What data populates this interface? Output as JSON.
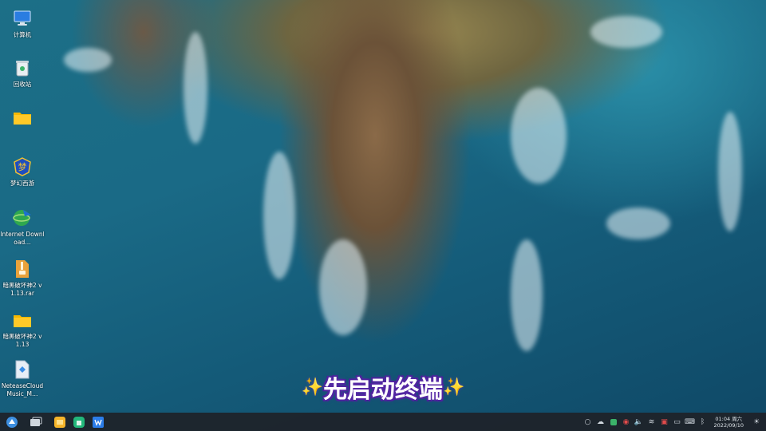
{
  "desktop": {
    "icons": [
      {
        "label": "计算机",
        "icon": "computer-icon"
      },
      {
        "label": "回收站",
        "icon": "trash-icon"
      },
      {
        "label": "",
        "icon": "folder-icon"
      },
      {
        "label": "梦幻西游",
        "icon": "game-icon"
      },
      {
        "label": "Internet Download…",
        "icon": "idm-icon"
      },
      {
        "label": "暗黑破坏神2 v1.13.rar",
        "icon": "archive-icon"
      },
      {
        "label": "暗黑破坏神2 v1.13",
        "icon": "folder-icon"
      },
      {
        "label": "NeteaseCloudMusic_M…",
        "icon": "installer-icon"
      }
    ]
  },
  "caption": {
    "text": "先启动终端"
  },
  "taskbar": {
    "apps": [
      "launcher-icon",
      "multitask-view-icon",
      "file-manager-icon",
      "app-store-icon",
      "writer-icon"
    ],
    "tray": [
      "search-icon",
      "cloud-icon",
      "green-app-icon",
      "record-icon",
      "volume-icon",
      "wifi-icon",
      "screenshot-icon",
      "display-icon",
      "keyboard-icon",
      "bluetooth-icon"
    ],
    "clock": {
      "time": "01:04 周六",
      "date": "2022/09/10"
    }
  },
  "colors": {
    "caption_outline": "#5a2da8",
    "sparkle": "#f6d34a",
    "taskbar": "#1e2228"
  }
}
